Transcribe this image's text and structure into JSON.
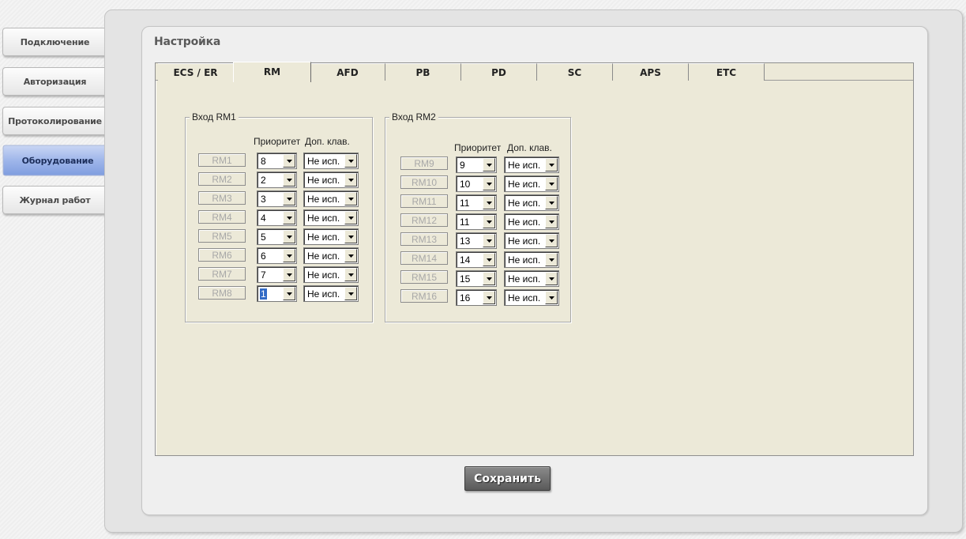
{
  "sidebar": {
    "items": [
      {
        "label": "Подключение"
      },
      {
        "label": "Авторизация"
      },
      {
        "label": "Протоколирование"
      },
      {
        "label": "Оборудование"
      },
      {
        "label": "Журнал работ"
      }
    ],
    "active_index": 3
  },
  "panel": {
    "title": "Настройка",
    "tabs": [
      {
        "label": "ECS / ER"
      },
      {
        "label": "RM"
      },
      {
        "label": "AFD"
      },
      {
        "label": "PB"
      },
      {
        "label": "PD"
      },
      {
        "label": "SC"
      },
      {
        "label": "APS"
      },
      {
        "label": "ETC"
      }
    ],
    "selected_tab": "RM"
  },
  "groups": [
    {
      "title": "Вход RM1",
      "priority_header": "Приоритет",
      "extra_header": "Доп. клав.",
      "rows": [
        {
          "name": "RM1",
          "priority": "8",
          "extra": "Не исп."
        },
        {
          "name": "RM2",
          "priority": "2",
          "extra": "Не исп."
        },
        {
          "name": "RM3",
          "priority": "3",
          "extra": "Не исп."
        },
        {
          "name": "RM4",
          "priority": "4",
          "extra": "Не исп."
        },
        {
          "name": "RM5",
          "priority": "5",
          "extra": "Не исп."
        },
        {
          "name": "RM6",
          "priority": "6",
          "extra": "Не исп."
        },
        {
          "name": "RM7",
          "priority": "7",
          "extra": "Не исп."
        },
        {
          "name": "RM8",
          "priority": "1",
          "extra": "Не исп."
        }
      ]
    },
    {
      "title": "Вход RM2",
      "priority_header": "Приоритет",
      "extra_header": "Доп. клав.",
      "rows": [
        {
          "name": "RM9",
          "priority": "9",
          "extra": "Не исп."
        },
        {
          "name": "RM10",
          "priority": "10",
          "extra": "Не исп."
        },
        {
          "name": "RM11",
          "priority": "11",
          "extra": "Не исп."
        },
        {
          "name": "RM12",
          "priority": "11",
          "extra": "Не исп."
        },
        {
          "name": "RM13",
          "priority": "13",
          "extra": "Не исп."
        },
        {
          "name": "RM14",
          "priority": "14",
          "extra": "Не исп."
        },
        {
          "name": "RM15",
          "priority": "15",
          "extra": "Не исп."
        },
        {
          "name": "RM16",
          "priority": "16",
          "extra": "Не исп."
        }
      ]
    }
  ],
  "save_label": "Сохранить",
  "colors": {
    "tab_background": "#ece9d8",
    "active_nav": "#8fa9e0",
    "selection": "#316ac5"
  }
}
